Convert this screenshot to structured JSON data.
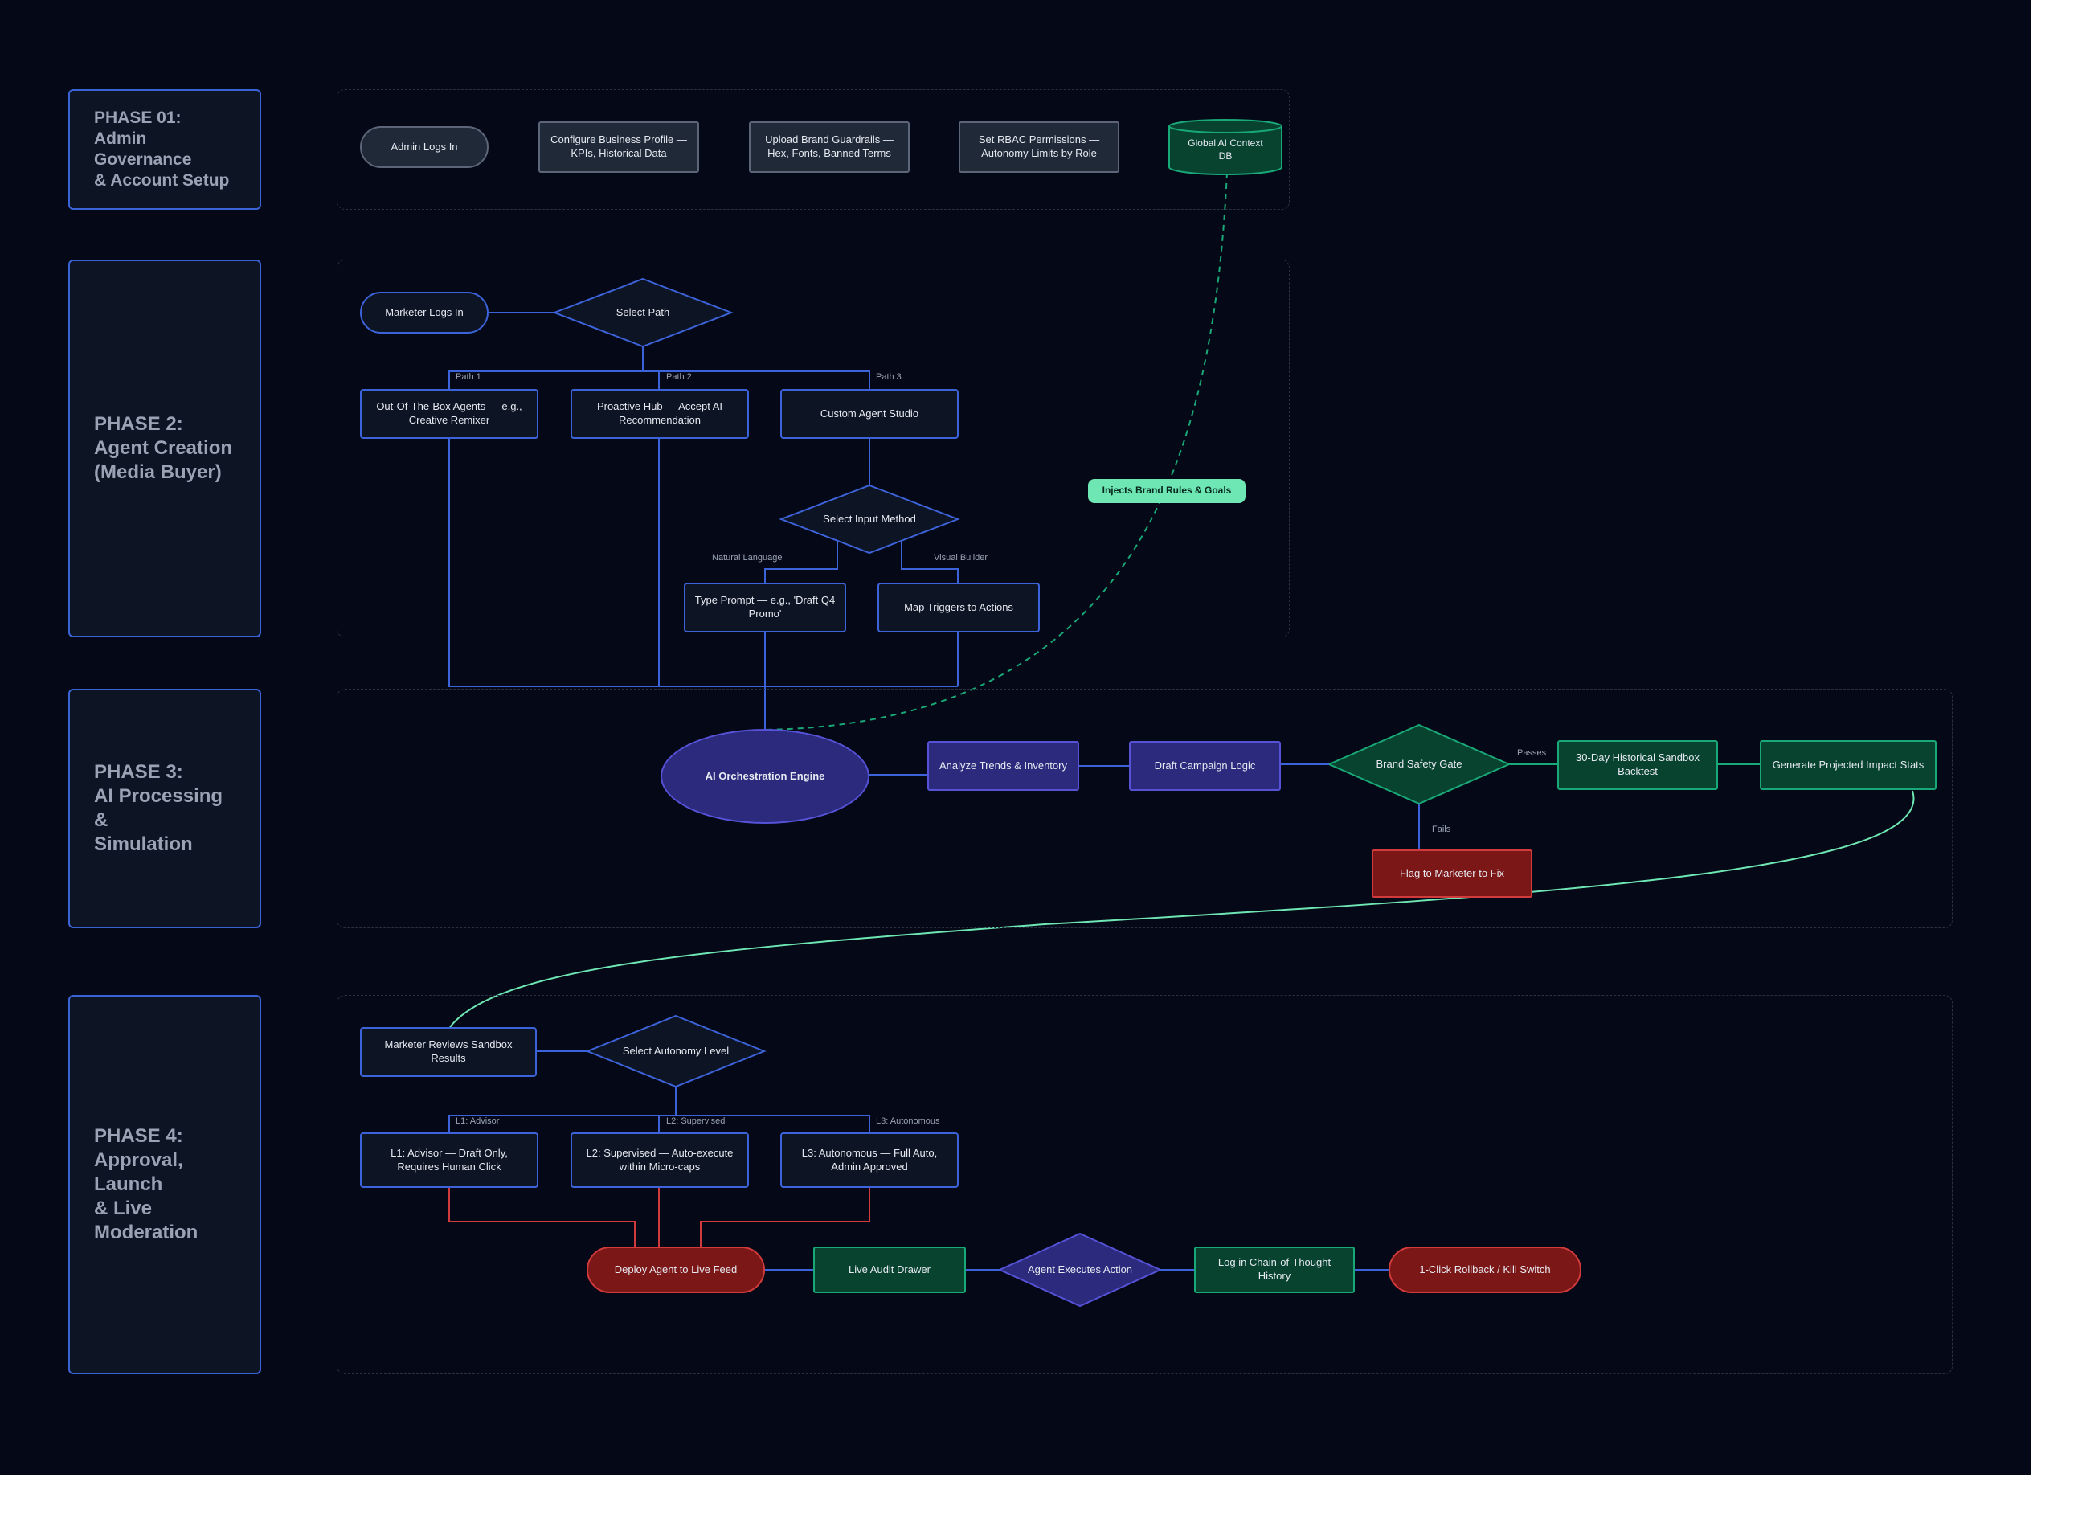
{
  "phases": [
    {
      "label": "PHASE 01:\nAdmin Governance\n& Account Setup"
    },
    {
      "label": "PHASE 2:\nAgent Creation\n(Media Buyer)"
    },
    {
      "label": "PHASE 3:\nAI Processing &\nSimulation"
    },
    {
      "label": "PHASE 4:\nApproval, Launch\n& Live Moderation"
    }
  ],
  "nodes": {
    "admin_login": "Admin Logs In",
    "config_profile": "Configure Business Profile — KPIs, Historical Data",
    "upload_brand": "Upload Brand Guardrails — Hex, Fonts, Banned Terms",
    "set_rbac": "Set RBAC Permissions — Autonomy Limits by Role",
    "global_db": "Global AI Context DB",
    "marketer_login": "Marketer Logs In",
    "select_path": "Select Path",
    "ootb_agents": "Out-Of-The-Box Agents — e.g., Creative Remixer",
    "proactive_hub": "Proactive Hub — Accept AI Recommendation",
    "custom_studio": "Custom Agent Studio",
    "select_input": "Select Input Method",
    "type_prompt": "Type Prompt — e.g., 'Draft Q4 Promo'",
    "map_triggers": "Map Triggers to Actions",
    "inject_tag": "Injects Brand Rules & Goals",
    "ai_engine": "AI Orchestration Engine",
    "analyze_trends": "Analyze Trends & Inventory",
    "draft_logic": "Draft Campaign Logic",
    "brand_gate": "Brand Safety Gate",
    "sandbox_backtest": "30-Day Historical Sandbox Backtest",
    "impact_stats": "Generate Projected Impact Stats",
    "flag_marketer": "Flag to Marketer to Fix",
    "review_sandbox": "Marketer Reviews Sandbox Results",
    "select_autonomy": "Select Autonomy Level",
    "l1_advisor": "L1: Advisor — Draft Only, Requires Human Click",
    "l2_supervised": "L2: Supervised — Auto-execute within Micro-caps",
    "l3_autonomous": "L3: Autonomous — Full Auto, Admin Approved",
    "deploy_agent": "Deploy Agent to Live Feed",
    "audit_drawer": "Live Audit Drawer",
    "agent_executes": "Agent Executes Action",
    "log_history": "Log in Chain-of-Thought History",
    "rollback": "1-Click Rollback / Kill Switch"
  },
  "edge_labels": {
    "path1": "Path 1",
    "path2": "Path 2",
    "path3": "Path 3",
    "natural_language": "Natural Language",
    "visual_builder": "Visual Builder",
    "passes": "Passes",
    "fails": "Fails",
    "l1": "L1: Advisor",
    "l2": "L2: Supervised",
    "l3": "L3: Autonomous"
  },
  "colors": {
    "background": "#050816",
    "blue_line": "#3c63d9",
    "green_line": "#19a877",
    "red_line": "#d23b3b",
    "purple": "#2b2a7c"
  }
}
